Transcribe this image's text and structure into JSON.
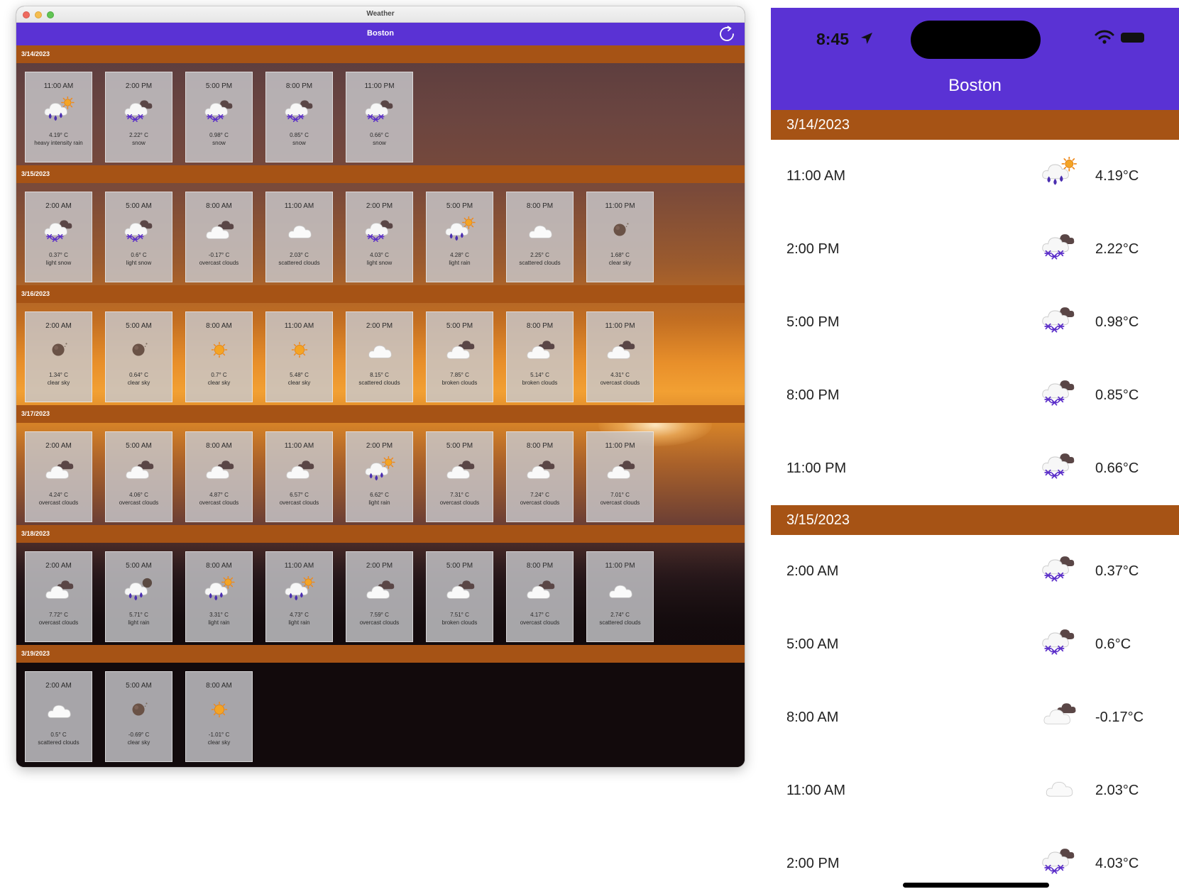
{
  "colors": {
    "nav": "#5a32d4",
    "day_header": "#a65315"
  },
  "desktop": {
    "window_title": "Weather",
    "nav_title": "Boston",
    "refresh_icon": "refresh-icon",
    "days": [
      {
        "date": "3/14/2023",
        "forecasts": [
          {
            "time": "11:00 AM",
            "temp": "4.19° C",
            "desc": "heavy intensity rain",
            "icon": "rain-sun"
          },
          {
            "time": "2:00 PM",
            "temp": "2.22° C",
            "desc": "snow",
            "icon": "snow-cloud"
          },
          {
            "time": "5:00 PM",
            "temp": "0.98° C",
            "desc": "snow",
            "icon": "snow-cloud"
          },
          {
            "time": "8:00 PM",
            "temp": "0.85° C",
            "desc": "snow",
            "icon": "snow-cloud"
          },
          {
            "time": "11:00 PM",
            "temp": "0.66° C",
            "desc": "snow",
            "icon": "snow-cloud"
          }
        ]
      },
      {
        "date": "3/15/2023",
        "forecasts": [
          {
            "time": "2:00 AM",
            "temp": "0.37° C",
            "desc": "light snow",
            "icon": "snow-cloud"
          },
          {
            "time": "5:00 AM",
            "temp": "0.6° C",
            "desc": "light snow",
            "icon": "snow-cloud"
          },
          {
            "time": "8:00 AM",
            "temp": "-0.17° C",
            "desc": "overcast clouds",
            "icon": "overcast"
          },
          {
            "time": "11:00 AM",
            "temp": "2.03° C",
            "desc": "scattered clouds",
            "icon": "cloud"
          },
          {
            "time": "2:00 PM",
            "temp": "4.03° C",
            "desc": "light snow",
            "icon": "snow-cloud"
          },
          {
            "time": "5:00 PM",
            "temp": "4.28° C",
            "desc": "light rain",
            "icon": "rain-sun"
          },
          {
            "time": "8:00 PM",
            "temp": "2.25° C",
            "desc": "scattered clouds",
            "icon": "cloud"
          },
          {
            "time": "11:00 PM",
            "temp": "1.68° C",
            "desc": "clear sky",
            "icon": "moon"
          }
        ]
      },
      {
        "date": "3/16/2023",
        "forecasts": [
          {
            "time": "2:00 AM",
            "temp": "1.34° C",
            "desc": "clear sky",
            "icon": "moon"
          },
          {
            "time": "5:00 AM",
            "temp": "0.64° C",
            "desc": "clear sky",
            "icon": "moon"
          },
          {
            "time": "8:00 AM",
            "temp": "0.7° C",
            "desc": "clear sky",
            "icon": "sun"
          },
          {
            "time": "11:00 AM",
            "temp": "5.48° C",
            "desc": "clear sky",
            "icon": "sun"
          },
          {
            "time": "2:00 PM",
            "temp": "8.15° C",
            "desc": "scattered clouds",
            "icon": "cloud"
          },
          {
            "time": "5:00 PM",
            "temp": "7.85° C",
            "desc": "broken clouds",
            "icon": "overcast"
          },
          {
            "time": "8:00 PM",
            "temp": "5.14° C",
            "desc": "broken clouds",
            "icon": "overcast"
          },
          {
            "time": "11:00 PM",
            "temp": "4.31° C",
            "desc": "overcast clouds",
            "icon": "overcast"
          }
        ]
      },
      {
        "date": "3/17/2023",
        "forecasts": [
          {
            "time": "2:00 AM",
            "temp": "4.24° C",
            "desc": "overcast clouds",
            "icon": "overcast"
          },
          {
            "time": "5:00 AM",
            "temp": "4.06° C",
            "desc": "overcast clouds",
            "icon": "overcast"
          },
          {
            "time": "8:00 AM",
            "temp": "4.87° C",
            "desc": "overcast clouds",
            "icon": "overcast"
          },
          {
            "time": "11:00 AM",
            "temp": "6.57° C",
            "desc": "overcast clouds",
            "icon": "overcast"
          },
          {
            "time": "2:00 PM",
            "temp": "6.62° C",
            "desc": "light rain",
            "icon": "rain-sun"
          },
          {
            "time": "5:00 PM",
            "temp": "7.31° C",
            "desc": "overcast clouds",
            "icon": "overcast"
          },
          {
            "time": "8:00 PM",
            "temp": "7.24° C",
            "desc": "overcast clouds",
            "icon": "overcast"
          },
          {
            "time": "11:00 PM",
            "temp": "7.01° C",
            "desc": "overcast clouds",
            "icon": "overcast"
          }
        ]
      },
      {
        "date": "3/18/2023",
        "forecasts": [
          {
            "time": "2:00 AM",
            "temp": "7.72° C",
            "desc": "overcast clouds",
            "icon": "overcast"
          },
          {
            "time": "5:00 AM",
            "temp": "5.71° C",
            "desc": "light rain",
            "icon": "rain-moon"
          },
          {
            "time": "8:00 AM",
            "temp": "3.31° C",
            "desc": "light rain",
            "icon": "rain-sun"
          },
          {
            "time": "11:00 AM",
            "temp": "4.73° C",
            "desc": "light rain",
            "icon": "rain-sun"
          },
          {
            "time": "2:00 PM",
            "temp": "7.59° C",
            "desc": "overcast clouds",
            "icon": "overcast"
          },
          {
            "time": "5:00 PM",
            "temp": "7.51° C",
            "desc": "broken clouds",
            "icon": "overcast"
          },
          {
            "time": "8:00 PM",
            "temp": "4.17° C",
            "desc": "overcast clouds",
            "icon": "overcast"
          },
          {
            "time": "11:00 PM",
            "temp": "2.74° C",
            "desc": "scattered clouds",
            "icon": "cloud"
          }
        ]
      },
      {
        "date": "3/19/2023",
        "forecasts": [
          {
            "time": "2:00 AM",
            "temp": "0.5° C",
            "desc": "scattered clouds",
            "icon": "cloud"
          },
          {
            "time": "5:00 AM",
            "temp": "-0.69° C",
            "desc": "clear sky",
            "icon": "moon"
          },
          {
            "time": "8:00 AM",
            "temp": "-1.01° C",
            "desc": "clear sky",
            "icon": "sun"
          }
        ]
      }
    ]
  },
  "phone": {
    "status_time": "8:45",
    "title": "Boston",
    "status_icons": [
      "location-arrow-icon",
      "wifi-icon",
      "battery-icon"
    ],
    "days": [
      {
        "date": "3/14/2023",
        "rows": [
          {
            "time": "11:00 AM",
            "temp": "4.19°C",
            "icon": "rain-sun"
          },
          {
            "time": "2:00 PM",
            "temp": "2.22°C",
            "icon": "snow-cloud"
          },
          {
            "time": "5:00 PM",
            "temp": "0.98°C",
            "icon": "snow-cloud"
          },
          {
            "time": "8:00 PM",
            "temp": "0.85°C",
            "icon": "snow-cloud"
          },
          {
            "time": "11:00 PM",
            "temp": "0.66°C",
            "icon": "snow-cloud"
          }
        ]
      },
      {
        "date": "3/15/2023",
        "rows": [
          {
            "time": "2:00 AM",
            "temp": "0.37°C",
            "icon": "snow-cloud"
          },
          {
            "time": "5:00 AM",
            "temp": "0.6°C",
            "icon": "snow-cloud"
          },
          {
            "time": "8:00 AM",
            "temp": "-0.17°C",
            "icon": "overcast"
          },
          {
            "time": "11:00 AM",
            "temp": "2.03°C",
            "icon": "cloud"
          },
          {
            "time": "2:00 PM",
            "temp": "4.03°C",
            "icon": "snow-cloud"
          }
        ]
      }
    ]
  }
}
